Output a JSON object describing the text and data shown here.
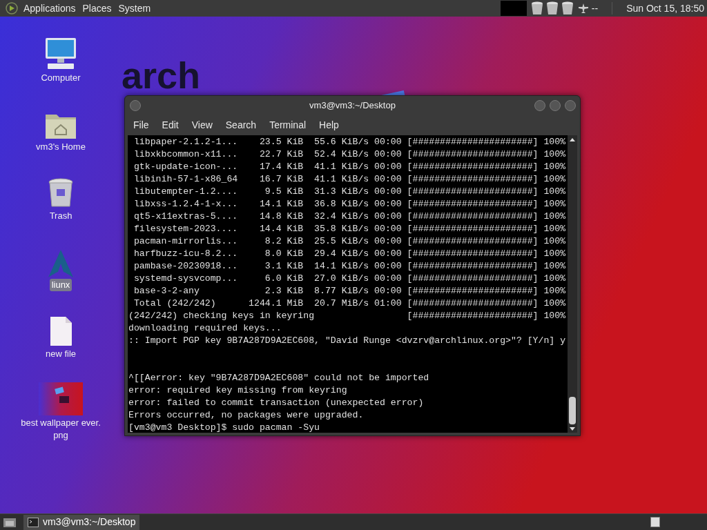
{
  "top_panel": {
    "menus": [
      "Applications",
      "Places",
      "System"
    ],
    "clock": "Sun Oct 15, 18:50",
    "tray_text": "--"
  },
  "desktop": {
    "wallpaper_text": "arch",
    "icons": [
      {
        "kind": "computer",
        "label": "Computer",
        "selected": false
      },
      {
        "kind": "home",
        "label": "vm3's Home",
        "selected": false
      },
      {
        "kind": "trash",
        "label": "Trash",
        "selected": false
      },
      {
        "kind": "arch",
        "label": "liunx",
        "selected": true
      },
      {
        "kind": "file",
        "label": "new file",
        "selected": false
      },
      {
        "label": "best wallpaper ever.\npng",
        "selected": false
      }
    ]
  },
  "terminal": {
    "title": "vm3@vm3:~/Desktop",
    "menus": [
      "File",
      "Edit",
      "View",
      "Search",
      "Terminal",
      "Help"
    ],
    "lines": [
      " libpaper-2.1.2-1...    23.5 KiB  55.6 KiB/s 00:00 [######################] 100%",
      " libxkbcommon-x11...    22.7 KiB  52.4 KiB/s 00:00 [######################] 100%",
      " gtk-update-icon-...    17.4 KiB  41.1 KiB/s 00:00 [######################] 100%",
      " libinih-57-1-x86_64    16.7 KiB  41.1 KiB/s 00:00 [######################] 100%",
      " libutempter-1.2....     9.5 KiB  31.3 KiB/s 00:00 [######################] 100%",
      " libxss-1.2.4-1-x...    14.1 KiB  36.8 KiB/s 00:00 [######################] 100%",
      " qt5-x11extras-5....    14.8 KiB  32.4 KiB/s 00:00 [######################] 100%",
      " filesystem-2023....    14.4 KiB  35.8 KiB/s 00:00 [######################] 100%",
      " pacman-mirrorlis...     8.2 KiB  25.5 KiB/s 00:00 [######################] 100%",
      " harfbuzz-icu-8.2...     8.0 KiB  29.4 KiB/s 00:00 [######################] 100%",
      " pambase-20230918...     3.1 KiB  14.1 KiB/s 00:00 [######################] 100%",
      " systemd-sysvcomp...     6.0 KiB  27.0 KiB/s 00:00 [######################] 100%",
      " base-3-2-any            2.3 KiB  8.77 KiB/s 00:00 [######################] 100%",
      " Total (242/242)      1244.1 MiB  20.7 MiB/s 01:00 [######################] 100%",
      "(242/242) checking keys in keyring                 [######################] 100%",
      "downloading required keys...",
      ":: Import PGP key 9B7A287D9A2EC608, \"David Runge <dvzrv@archlinux.org>\"? [Y/n] y"
    ],
    "error_lines": [
      "^[[Aerror: key \"9B7A287D9A2EC608\" could not be imported",
      "error: required key missing from keyring",
      "error: failed to commit transaction (unexpected error)",
      "Errors occurred, no packages were upgraded.",
      "[vm3@vm3 Desktop]$ sudo pacman -Syu"
    ]
  },
  "taskbar": {
    "tasks": [
      {
        "label": "vm3@vm3:~/Desktop",
        "selected": true
      }
    ]
  }
}
